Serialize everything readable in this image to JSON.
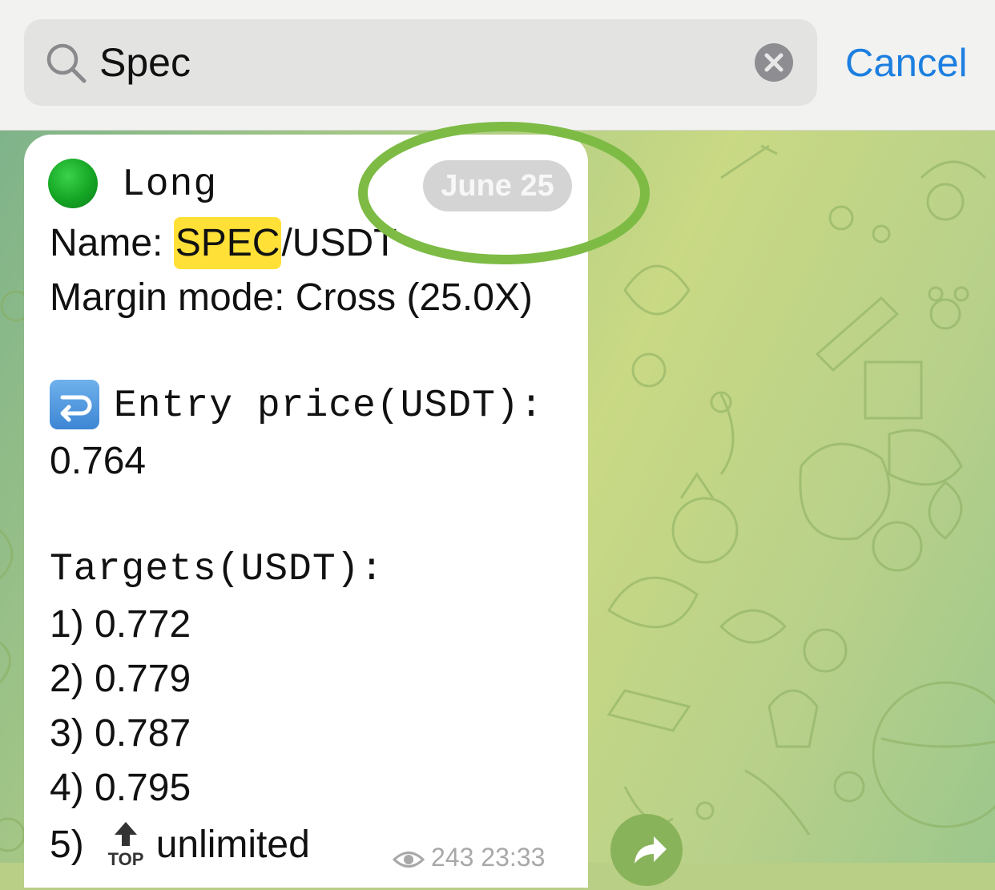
{
  "search": {
    "query": "Spec",
    "cancel_label": "Cancel"
  },
  "message": {
    "direction_dot_color": "#14a524",
    "direction": "Long",
    "name_prefix": "Name: ",
    "name_highlight": "SPEC",
    "name_suffix": "/USDT",
    "margin_line": "Margin mode: Cross (25.0X)",
    "entry_label": "Entry price(USDT):",
    "entry_value": "0.764",
    "targets_label": "Targets(USDT):",
    "targets": [
      "1) 0.772",
      "2) 0.779",
      "3) 0.787",
      "4) 0.795"
    ],
    "target5_prefix": "5)",
    "target5_icon": "TOP",
    "target5_value": "unlimited",
    "date": "June 25",
    "views": "243",
    "time": "23:33"
  },
  "colors": {
    "accent": "#1d7fe0",
    "highlight": "#ffe036",
    "annotation": "#7dbb45"
  }
}
